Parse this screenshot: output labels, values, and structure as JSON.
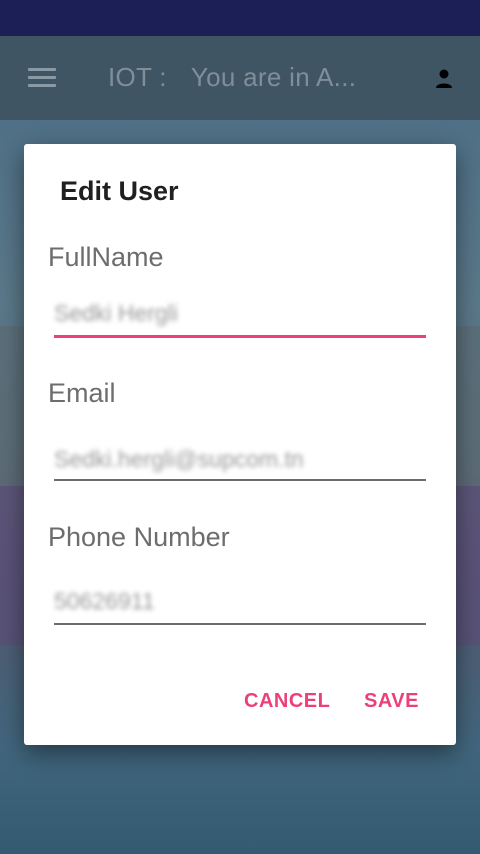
{
  "app_bar": {
    "title": "IOT :",
    "subtitle": "You are in A..."
  },
  "icons": {
    "menu": "hamburger-menu-icon",
    "account": "person-icon"
  },
  "dialog": {
    "title": "Edit User",
    "fields": [
      {
        "label": "FullName",
        "value": "Sedki Hergli",
        "focused": true
      },
      {
        "label": "Email",
        "value": "Sedki.hergli@supcom.tn",
        "focused": false
      },
      {
        "label": "Phone Number",
        "value": "50626911",
        "focused": false
      }
    ],
    "cancel_label": "CANCEL",
    "save_label": "SAVE"
  },
  "colors": {
    "accent": "#ec407a",
    "status_bar": "#1c1f55"
  }
}
